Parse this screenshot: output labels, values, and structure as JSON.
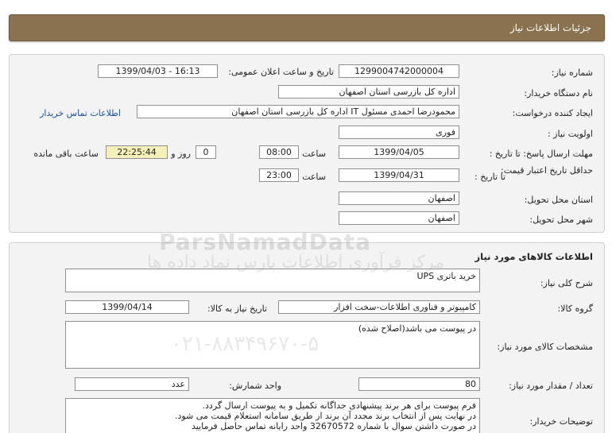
{
  "header": {
    "title": "جزئیات اطلاعات نیاز"
  },
  "need_info": {
    "need_number_label": "شماره نیاز:",
    "need_number": "1299004742000004",
    "announce_label": "تاریخ و ساعت اعلان عمومی:",
    "announce_value": "1399/04/03 - 16:13",
    "buyer_org_label": "نام دستگاه خریدار:",
    "buyer_org": "اداره کل بازرسی استان اصفهان",
    "creator_label": "ایجاد کننده درخواست:",
    "creator": "محمودرضا احمدی مسئول IT اداره کل بازرسی استان اصفهان",
    "contact_link": "اطلاعات تماس خریدار",
    "priority_label": "اولویت نیاز :",
    "priority": "فوری",
    "reply_deadline_label": "مهلت ارسال پاسخ: تا تاریخ :",
    "reply_date": "1399/04/05",
    "time_label": "ساعت",
    "reply_time": "08:00",
    "days_value": "0",
    "days_label": "روز و",
    "remaining_time": "22:25:44",
    "remaining_label": "ساعت باقی مانده",
    "validity_label": "حداقل تاریخ اعتبار قیمت:",
    "validity_until_label": "تا تاریخ :",
    "validity_date": "1399/04/31",
    "validity_time_label": "ساعت",
    "validity_time": "23:00",
    "province_label": "استان محل تحویل:",
    "province": "اصفهان",
    "city_label": "شهر محل تحویل:",
    "city": "اصفهان"
  },
  "goods_info": {
    "section_title": "اطلاعات کالاهای مورد نیاز",
    "summary_label": "شرح کلی نیاز:",
    "summary": "خرید باتری UPS",
    "group_label": "گروه کالا:",
    "group": "کامپیوتر و فناوری اطلاعات-سخت افزار",
    "need_date_label": "تاریخ نیاز به کالا:",
    "need_date": "1399/04/14",
    "specs_label": "مشخصات کالای مورد نیاز:",
    "specs": "در پیوست می باشد(اصلاح شده)",
    "qty_label": "تعداد / مقدار مورد نیاز:",
    "qty": "80",
    "unit_label": "واحد شمارش:",
    "unit": "عدد",
    "desc_label": "توضیحات خریدار:",
    "desc_lines": [
      "فرم پیوست برای هر برند پیشنهادی جداگانه تکمیل و به پیوست ارسال گردد.",
      "در نهایت پس از انتخاب برند مجدد آن برند از طریق سامانه استعلام قیمت می شود.",
      "در صورت داشتن سوال با شماره 32670572 واحد رایانه تماس حاصل فرمایید"
    ]
  },
  "watermark": {
    "brand": "ParsNamadData",
    "tagline": "مرکز فرآوری اطلاعات پارس نماد داده ها",
    "phone": "۰۲۱-۸۸۳۴۹۶۷۰-۵"
  }
}
